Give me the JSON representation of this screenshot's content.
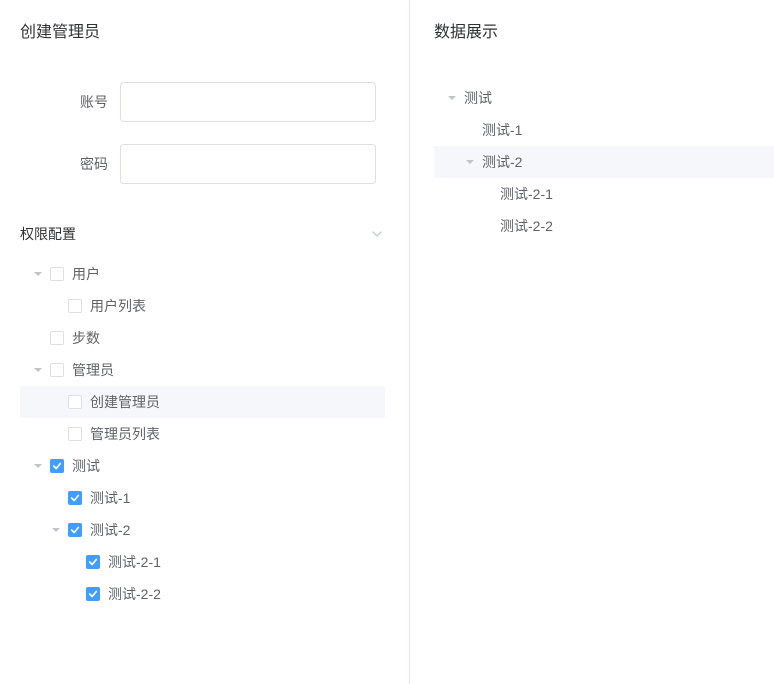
{
  "left": {
    "title": "创建管理员",
    "form": {
      "account_label": "账号",
      "account_value": "",
      "password_label": "密码",
      "password_value": ""
    },
    "perm_section_label": "权限配置"
  },
  "right": {
    "title": "数据展示"
  },
  "perm_tree": [
    {
      "label": "用户",
      "checked": false,
      "expanded": true,
      "highlight": false,
      "children": [
        {
          "label": "用户列表",
          "checked": false,
          "expanded": false,
          "leaf": true,
          "highlight": false
        }
      ]
    },
    {
      "label": "步数",
      "checked": false,
      "expanded": false,
      "highlight": false,
      "children": []
    },
    {
      "label": "管理员",
      "checked": false,
      "expanded": true,
      "highlight": false,
      "children": [
        {
          "label": "创建管理员",
          "checked": false,
          "expanded": false,
          "leaf": true,
          "highlight": true
        },
        {
          "label": "管理员列表",
          "checked": false,
          "expanded": false,
          "leaf": true,
          "highlight": false
        }
      ]
    },
    {
      "label": "测试",
      "checked": true,
      "expanded": true,
      "highlight": false,
      "children": [
        {
          "label": "测试-1",
          "checked": true,
          "expanded": false,
          "leaf": true,
          "highlight": false
        },
        {
          "label": "测试-2",
          "checked": true,
          "expanded": true,
          "highlight": false,
          "children": [
            {
              "label": "测试-2-1",
              "checked": true,
              "expanded": false,
              "leaf": true,
              "highlight": false
            },
            {
              "label": "测试-2-2",
              "checked": true,
              "expanded": false,
              "leaf": true,
              "highlight": false
            }
          ]
        }
      ]
    }
  ],
  "data_tree": [
    {
      "label": "测试",
      "expanded": true,
      "highlight": false,
      "children": [
        {
          "label": "测试-1",
          "expanded": false,
          "leaf": true,
          "highlight": false
        },
        {
          "label": "测试-2",
          "expanded": true,
          "highlight": true,
          "children": [
            {
              "label": "测试-2-1",
              "expanded": false,
              "leaf": true,
              "highlight": false
            },
            {
              "label": "测试-2-2",
              "expanded": false,
              "leaf": true,
              "highlight": false
            }
          ]
        }
      ]
    }
  ]
}
